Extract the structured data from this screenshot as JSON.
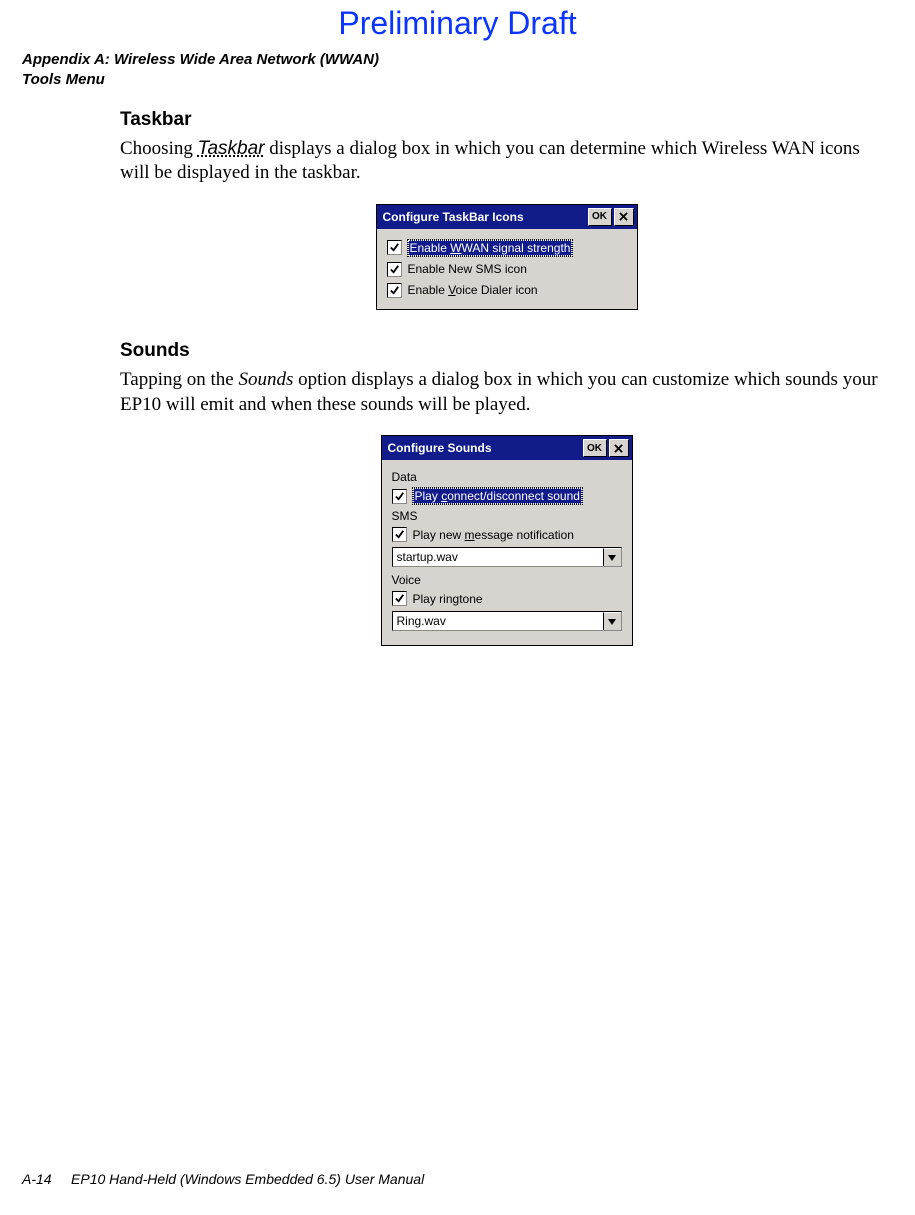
{
  "watermark": "Preliminary Draft",
  "header": {
    "line1": "Appendix A: Wireless Wide Area Network (WWAN)",
    "line2": "Tools Menu"
  },
  "sections": {
    "taskbar": {
      "heading": "Taskbar",
      "p_pre": "Choosing ",
      "p_term": "Taskbar",
      "p_post": " displays a dialog box in which you can determine which Wireless WAN icons will be displayed in the taskbar."
    },
    "sounds": {
      "heading": "Sounds",
      "p_pre": "Tapping on the ",
      "p_term": "Sounds",
      "p_post": " option displays a dialog box in which you can customize which sounds your EP10 will emit and when these sounds will be played."
    }
  },
  "dialog1": {
    "title": "Configure TaskBar Icons",
    "ok": "OK",
    "items": {
      "c1_pre": "Enable ",
      "c1_u": "W",
      "c1_post": "WAN signal strength",
      "c2": "Enable New SMS icon",
      "c3_pre": "Enable ",
      "c3_u": "V",
      "c3_post": "oice Dialer icon"
    }
  },
  "dialog2": {
    "title": "Configure Sounds",
    "ok": "OK",
    "groups": {
      "data": {
        "label": "Data",
        "c_pre": "Play ",
        "c_u": "c",
        "c_post": "onnect/disconnect sound"
      },
      "sms": {
        "label": "SMS",
        "c_pre": "Play new ",
        "c_u": "m",
        "c_post": "essage notification",
        "combo": "startup.wav"
      },
      "voice": {
        "label": "Voice",
        "c": "Play ringtone",
        "combo": "Ring.wav"
      }
    }
  },
  "footer": {
    "page": "A-14",
    "title": "EP10 Hand-Held (Windows Embedded 6.5) User Manual"
  }
}
